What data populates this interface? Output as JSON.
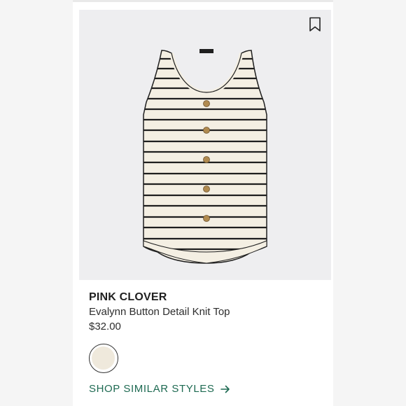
{
  "product": {
    "brand": "PINK CLOVER",
    "name": "Evalynn Button Detail Knit Top",
    "price": "$32.00",
    "image_icon": "striped-tank-top-image"
  },
  "swatches": [
    {
      "color": "#efe9dc",
      "selected": true
    }
  ],
  "actions": {
    "shop_similar": "SHOP SIMILAR STYLES",
    "bookmark_icon": "bookmark-icon",
    "arrow_icon": "arrow-right-icon"
  },
  "colors": {
    "accent": "#1e6a52",
    "image_background": "#eeeef0",
    "garment": "#f4efe3",
    "stripe": "#1f1f1f",
    "button": "#b08a4f"
  }
}
